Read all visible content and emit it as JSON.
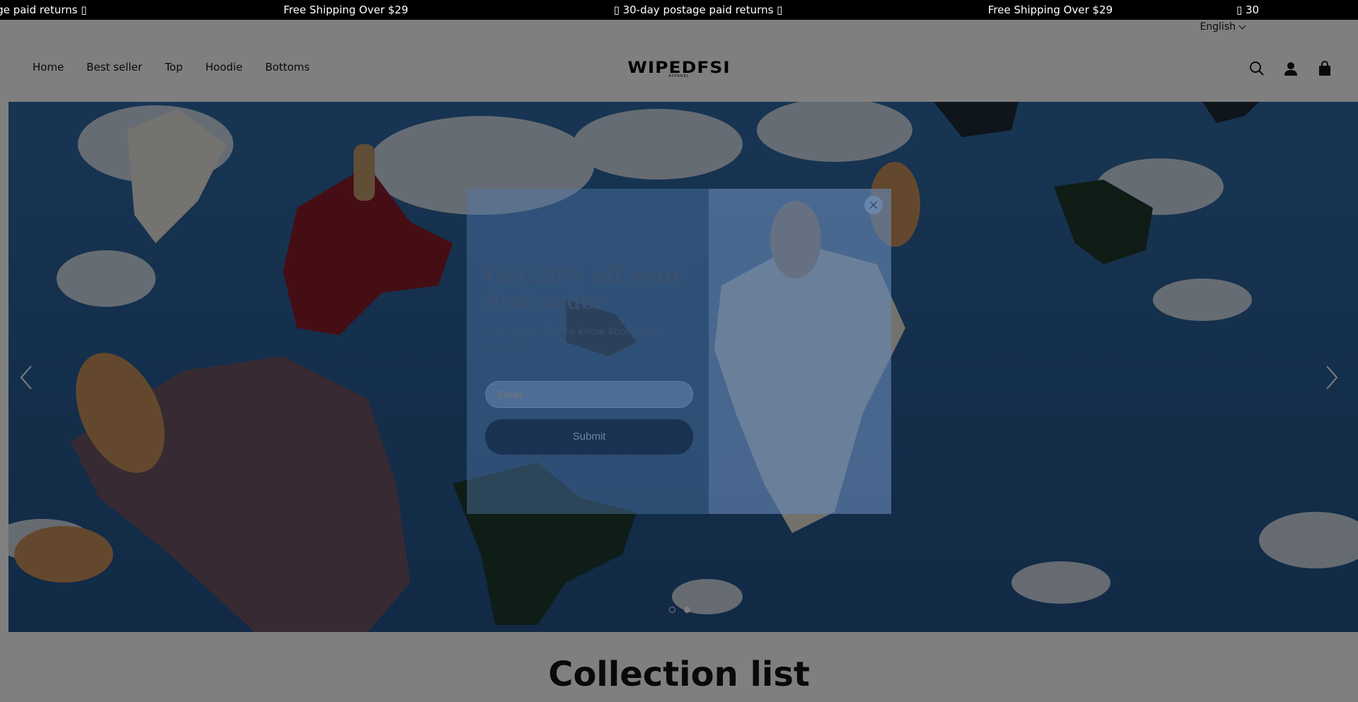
{
  "announcement": {
    "items": [
      "age paid returns ▯",
      "Free Shipping Over $29",
      "▯ 30-day postage paid returns ▯",
      "Free Shipping Over $29",
      "▯ 30"
    ]
  },
  "header": {
    "language": "English",
    "nav": [
      "Home",
      "Best seller",
      "Top",
      "Hoodie",
      "Bottoms"
    ],
    "logo": "WIPEDFSI",
    "logo_sub": "APPAREL",
    "icons": [
      "search-icon",
      "account-icon",
      "cart-icon"
    ]
  },
  "hero": {
    "slide_count": 2,
    "active_slide": 1
  },
  "popup": {
    "title": "Get 20% off your first order",
    "description": "And be the first to know about new products",
    "email_placeholder": "Email",
    "submit_label": "Submit"
  },
  "collection": {
    "title": "Collection list"
  },
  "colors": {
    "announcement_bg": "#000000",
    "sky": "#2a5d94",
    "overlay": "rgba(0,0,0,0.5)"
  }
}
